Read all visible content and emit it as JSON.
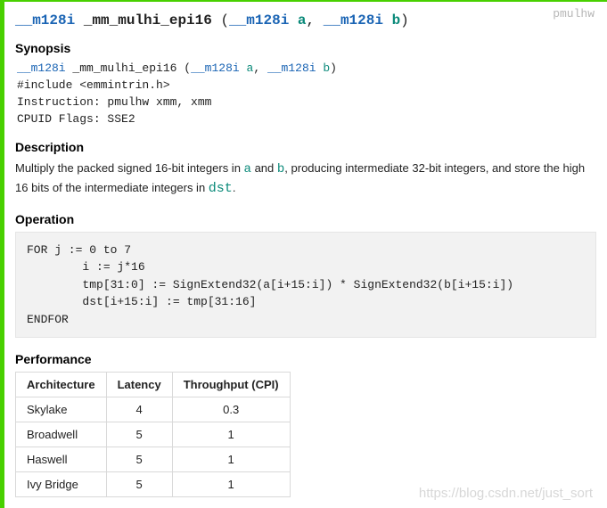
{
  "instruction_badge": "pmulhw",
  "signature": {
    "ret_type": "__m128i",
    "name": "_mm_mulhi_epi16",
    "param_a_type": "__m128i",
    "param_a_name": "a",
    "param_b_type": "__m128i",
    "param_b_name": "b"
  },
  "sections": {
    "synopsis": "Synopsis",
    "description": "Description",
    "operation": "Operation",
    "performance": "Performance"
  },
  "synopsis": {
    "sig_ret": "__m128i",
    "sig_name": "_mm_mulhi_epi16",
    "sig_pa_t": "__m128i",
    "sig_pa_n": "a",
    "sig_pb_t": "__m128i",
    "sig_pb_n": "b",
    "include_line": "#include <emmintrin.h>",
    "instruction_line": "Instruction: pmulhw xmm, xmm",
    "cpuid_line": "CPUID Flags: SSE2"
  },
  "description": {
    "pre_a": "Multiply the packed signed 16-bit integers in ",
    "a": "a",
    "between": " and ",
    "b": "b",
    "mid": ", producing intermediate 32-bit integers, and store the high 16 bits of the intermediate integers in ",
    "dst": "dst",
    "end": "."
  },
  "operation_code": "FOR j := 0 to 7\n        i := j*16\n        tmp[31:0] := SignExtend32(a[i+15:i]) * SignExtend32(b[i+15:i])\n        dst[i+15:i] := tmp[31:16]\nENDFOR",
  "performance": {
    "headers": {
      "arch": "Architecture",
      "lat": "Latency",
      "tp": "Throughput (CPI)"
    },
    "rows": [
      {
        "arch": "Skylake",
        "lat": "4",
        "tp": "0.3"
      },
      {
        "arch": "Broadwell",
        "lat": "5",
        "tp": "1"
      },
      {
        "arch": "Haswell",
        "lat": "5",
        "tp": "1"
      },
      {
        "arch": "Ivy Bridge",
        "lat": "5",
        "tp": "1"
      }
    ]
  },
  "watermark": "https://blog.csdn.net/just_sort"
}
